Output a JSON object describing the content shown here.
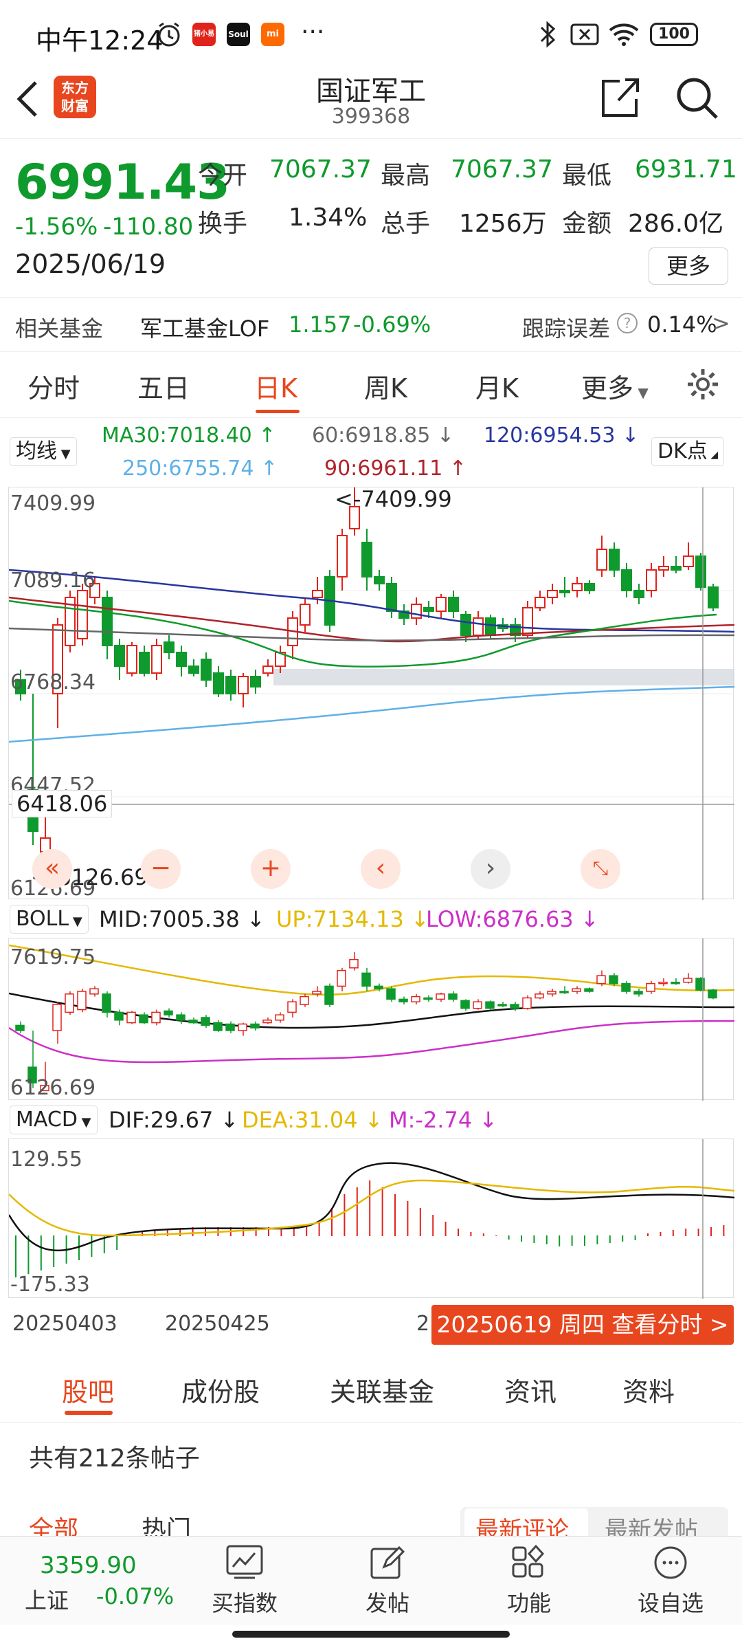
{
  "status_bar": {
    "time": "中午12:24",
    "badge_zhuxiaoyi": "猪小易",
    "badge_soul": "Soul",
    "badge_mi": "mi",
    "more_dots": "···",
    "battery": "100"
  },
  "header": {
    "title": "国证军工",
    "code": "399368",
    "logo_line1": "东方",
    "logo_line2": "财富"
  },
  "quote": {
    "price": "6991.43",
    "change_pct": "-1.56%",
    "change": "-110.80",
    "date": "2025/06/19",
    "open_label": "今开",
    "open": "7067.37",
    "high_label": "最高",
    "high": "7067.37",
    "low_label": "最低",
    "low": "6931.71",
    "turnover_label": "换手",
    "turnover": "1.34%",
    "volume_label": "总手",
    "volume": "1256万",
    "amount_label": "金额",
    "amount": "286.0亿",
    "more_button": "更多"
  },
  "fund": {
    "label": "相关基金",
    "name": "军工基金LOF",
    "price": "1.157",
    "change": "-0.69%",
    "tracking_label": "跟踪误差",
    "tracking_value": "0.14%"
  },
  "period_tabs": [
    "分时",
    "五日",
    "日K",
    "周K",
    "月K",
    "更多"
  ],
  "ma_legend": {
    "selector": "均线",
    "ma30": "MA30:7018.40",
    "ma60": "60:6918.85",
    "ma120": "120:6954.53",
    "ma250": "250:6755.74",
    "ma90": "90:6961.11",
    "dk_button": "DK点"
  },
  "kline": {
    "y_labels": [
      "7409.99",
      "7089.16",
      "6768.34",
      "6447.52",
      "6126.69"
    ],
    "high_marker": "<-7409.99",
    "low_marker": "<-6126.69",
    "crosshair_price": "6418.06"
  },
  "boll": {
    "selector": "BOLL",
    "mid": "MID:7005.38",
    "up": "UP:7134.13",
    "low": "LOW:6876.63",
    "y_top": "7619.75",
    "y_bottom": "6126.69"
  },
  "macd": {
    "selector": "MACD",
    "dif": "DIF:29.67",
    "dea": "DEA:31.04",
    "m": "M:-2.74",
    "y_top": "129.55",
    "y_bottom": "-175.33"
  },
  "date_axis": {
    "d1": "20250403",
    "d2": "20250425",
    "d3": "2",
    "pill": "20250619 周四 查看分时 >"
  },
  "bottom_tabs": [
    "股吧",
    "成份股",
    "关联基金",
    "资讯",
    "资料"
  ],
  "posts": {
    "count_text": "共有212条帖子",
    "tab_all": "全部",
    "tab_hot": "热门",
    "sort_latest_comment": "最新评论",
    "sort_latest_post": "最新发帖"
  },
  "nav": {
    "index_value": "3359.90",
    "index_name": "上证",
    "index_change": "-0.07%",
    "buy_index": "买指数",
    "post": "发帖",
    "function": "功能",
    "watchlist": "设自选"
  },
  "colors": {
    "accent": "#e8461f",
    "up": "#e0241b",
    "down": "#0e9a2c"
  }
}
